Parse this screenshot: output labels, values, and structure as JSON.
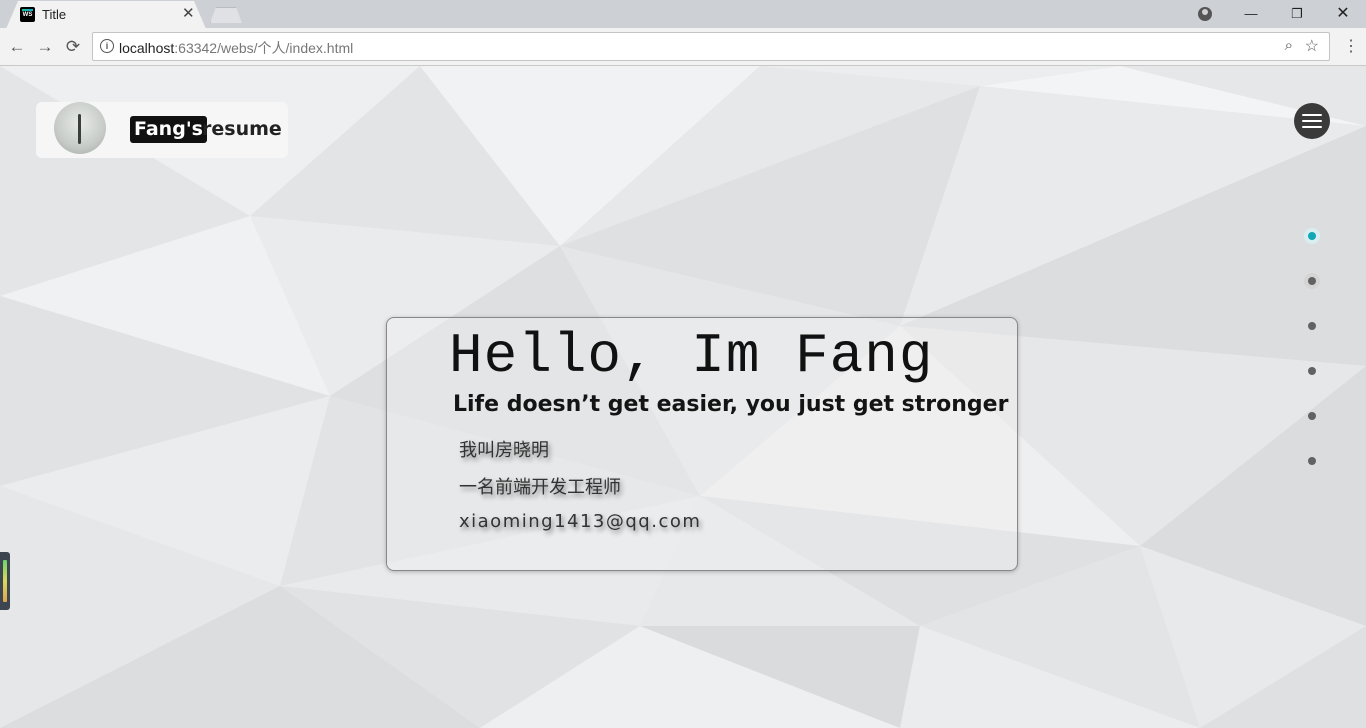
{
  "browser": {
    "tab_title": "Title",
    "tab_favicon_label": "WS",
    "url_host": "localhost",
    "url_path": ":63342/webs/个人/index.html"
  },
  "header": {
    "brand_highlight": "Fang's",
    "brand_rest": "resume"
  },
  "section_nav": {
    "dots": 6,
    "active_index": 0
  },
  "hero": {
    "title": "Hello, Im Fang",
    "tagline": "Life doesn’t get easier, you just get stronger",
    "name_cn": "我叫房晓明",
    "role_cn": "一名前端开发工程师",
    "email": "xiaoming1413@qq.com"
  },
  "colors": {
    "accent": "#13a6b5",
    "dot": "#626262",
    "menu_button": "#3a3a3a"
  }
}
